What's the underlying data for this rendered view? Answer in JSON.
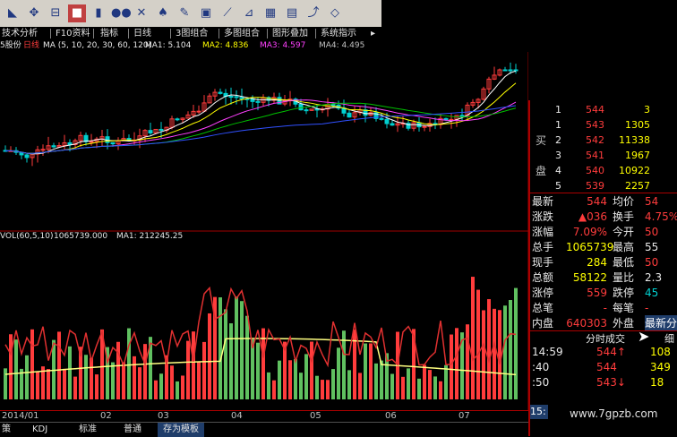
{
  "menu": [
    "技术分析",
    "F10资料",
    "指标",
    "日线",
    "3图组合",
    "多图组合",
    "图形叠加",
    "系统指示"
  ],
  "ma_bar": {
    "stock": "5股份",
    "period": "日线",
    "params": "MA (5, 10, 20, 30, 60, 120)",
    "ma1": "MA1: 5.104",
    "ma2": "MA2: 4.836",
    "ma3": "MA3: 4.597",
    "ma4": "MA4: 4.495"
  },
  "vol_bar": {
    "params": "VOL(60,5,10)",
    "value": "1065739.000",
    "ma1": "MA1: 212245.25"
  },
  "dates": [
    "2014/01",
    "02",
    "03",
    "04",
    "05",
    "06",
    "07"
  ],
  "tabs": [
    "策",
    "KDJ",
    "标准",
    "普通",
    "存为模板"
  ],
  "orderbook": {
    "side_buy": [
      "买",
      "盘"
    ],
    "rows": [
      {
        "lvl": "1",
        "price": "544",
        "vol": "3"
      },
      {
        "lvl": "1",
        "price": "543",
        "vol": "1305"
      },
      {
        "lvl": "2",
        "price": "542",
        "vol": "11338"
      },
      {
        "lvl": "3",
        "price": "541",
        "vol": "1967"
      },
      {
        "lvl": "4",
        "price": "540",
        "vol": "10922"
      },
      {
        "lvl": "5",
        "price": "539",
        "vol": "2257"
      }
    ]
  },
  "quote": [
    {
      "l1": "最新",
      "v1": "544",
      "l2": "均价",
      "v2": "54"
    },
    {
      "l1": "涨跌",
      "v1": "▲036",
      "l2": "换手",
      "v2": "4.75%"
    },
    {
      "l1": "涨幅",
      "v1": "7.09%",
      "l2": "今开",
      "v2": "50"
    },
    {
      "l1": "总手",
      "v1": "1065739",
      "l2": "最高",
      "v2": "55"
    },
    {
      "l1": "现手",
      "v1": "284",
      "l2": "最低",
      "v2": "50"
    },
    {
      "l1": "总额",
      "v1": "58122",
      "l2": "量比",
      "v2": "2.3"
    },
    {
      "l1": "涨停",
      "v1": "559",
      "l2": "跌停",
      "v2": "45"
    },
    {
      "l1": "总笔",
      "v1": "-",
      "l2": "每笔",
      "v2": "-"
    },
    {
      "l1": "内盘",
      "v1": "640303",
      "l2": "外盘",
      "v2": "最新分笔"
    }
  ],
  "ticks_header": {
    "title": "分时成交",
    "right": "细"
  },
  "ticks": [
    {
      "t": "14:59",
      "p": "544↑",
      "v": "108"
    },
    {
      "t": ":40",
      "p": "544",
      "v": "349"
    },
    {
      "t": ":50",
      "p": "543↓",
      "v": "18"
    }
  ],
  "corner_time": "15:",
  "watermark": "www.7gpzb.com",
  "colors": {
    "up": "#ff3c3c",
    "down": "#00d0d0",
    "ma_white": "#ffffff",
    "ma_yellow": "#ffff00",
    "ma_magenta": "#ff40ff",
    "ma_green": "#00c000",
    "ma_blue": "#3050ff"
  }
}
